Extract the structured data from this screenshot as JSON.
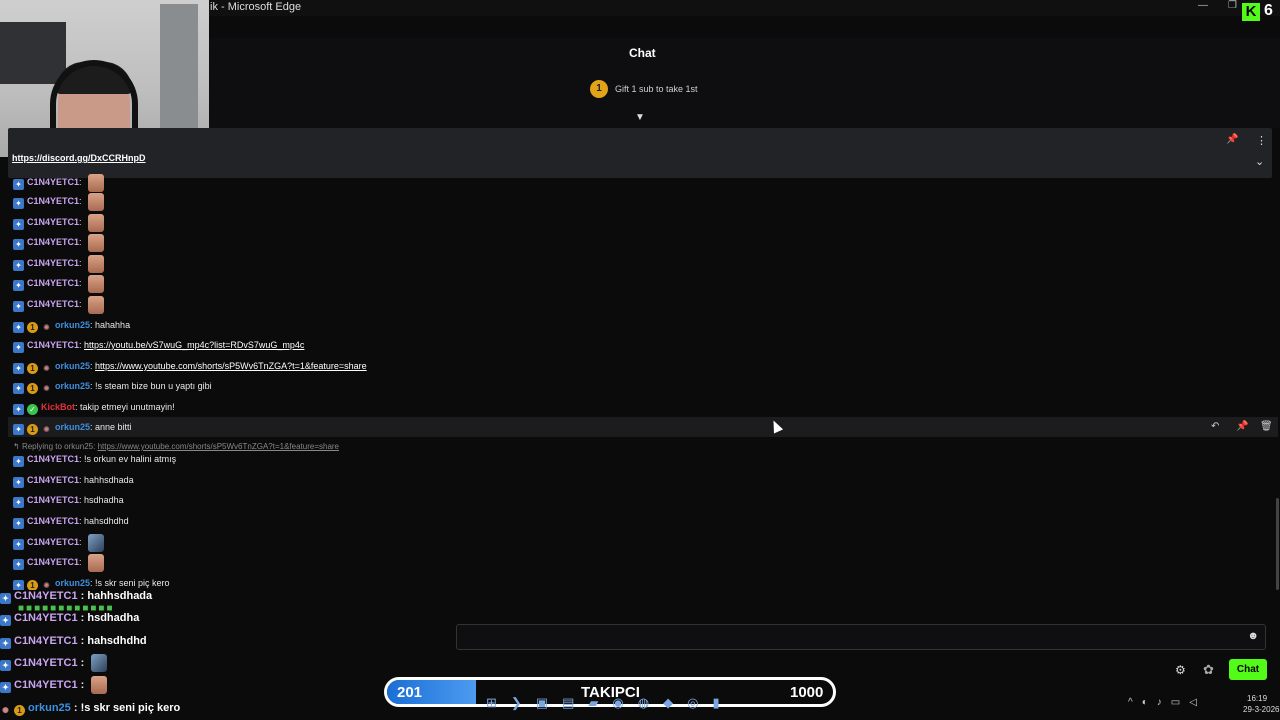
{
  "window": {
    "title": "ik - Microsoft Edge",
    "kick_count": "6"
  },
  "header": {
    "title": "Chat",
    "gift_badge": "1",
    "gift_text": "Gift 1 sub to take 1st"
  },
  "pinned": {
    "link": "https://discord.gg/DxCCRHnpD"
  },
  "messages": [
    {
      "user": "C1N4YETC1",
      "text": "",
      "emote": "face"
    },
    {
      "user": "C1N4YETC1",
      "text": "",
      "emote": "face"
    },
    {
      "user": "C1N4YETC1",
      "text": "",
      "emote": "face"
    },
    {
      "user": "C1N4YETC1",
      "text": "",
      "emote": "face"
    },
    {
      "user": "C1N4YETC1",
      "text": "",
      "emote": "face"
    },
    {
      "user": "C1N4YETC1",
      "text": "",
      "emote": "face"
    },
    {
      "user": "C1N4YETC1",
      "text": "",
      "emote": "face"
    },
    {
      "user": "orkun25",
      "text": "hahahha"
    },
    {
      "user": "C1N4YETC1",
      "text": "https://youtu.be/vS7wuG_mp4c?list=RDvS7wuG_mp4c"
    },
    {
      "user": "orkun25",
      "text": "https://www.youtube.com/shorts/sP5Wv6TnZGA?t=1&feature=share"
    },
    {
      "user": "orkun25",
      "text": "!s steam bize bun u yaptı gibi"
    },
    {
      "user": "KickBot",
      "text": "takip etmeyi unutmayin!"
    },
    {
      "user": "orkun25",
      "text": "anne bitti"
    },
    {
      "reply_prefix": "Replying to orkun25:",
      "reply_link": "https://www.youtube.com/shorts/sP5Wv6TnZGA?t=1&feature=share"
    },
    {
      "user": "C1N4YETC1",
      "text": "!s orkun ev halini atmış"
    },
    {
      "user": "C1N4YETC1",
      "text": "hahhsdhada"
    },
    {
      "user": "C1N4YETC1",
      "text": "hsdhadha"
    },
    {
      "user": "C1N4YETC1",
      "text": "hahsdhdhd"
    },
    {
      "user": "C1N4YETC1",
      "text": "",
      "emote": "bird"
    },
    {
      "user": "C1N4YETC1",
      "text": "",
      "emote": "face"
    },
    {
      "user": "orkun25",
      "text": "!s skr seni piç kero"
    }
  ],
  "overlay": [
    {
      "user": "C1N4YETC1",
      "text": "hahhsdhada"
    },
    {
      "user": "C1N4YETC1",
      "text": "hsdhadha"
    },
    {
      "user": "C1N4YETC1",
      "text": "hahsdhdhd"
    },
    {
      "user": "C1N4YETC1",
      "text": ""
    },
    {
      "user": "C1N4YETC1",
      "text": ""
    },
    {
      "user": "orkun25",
      "text": "!s skr seni piç kero"
    }
  ],
  "bottom": {
    "chat_button": "Chat"
  },
  "progress": {
    "start": "201",
    "label": "TAKIPCI",
    "end": "1000",
    "fill_fraction": 0.2
  },
  "clock": {
    "time": "16:19",
    "date": "29-3-2026"
  },
  "colors": {
    "accent": "#53fc18",
    "user_c": "#c9a5f0",
    "user_o": "#3d8fe0",
    "user_bot": "#e2313c"
  }
}
